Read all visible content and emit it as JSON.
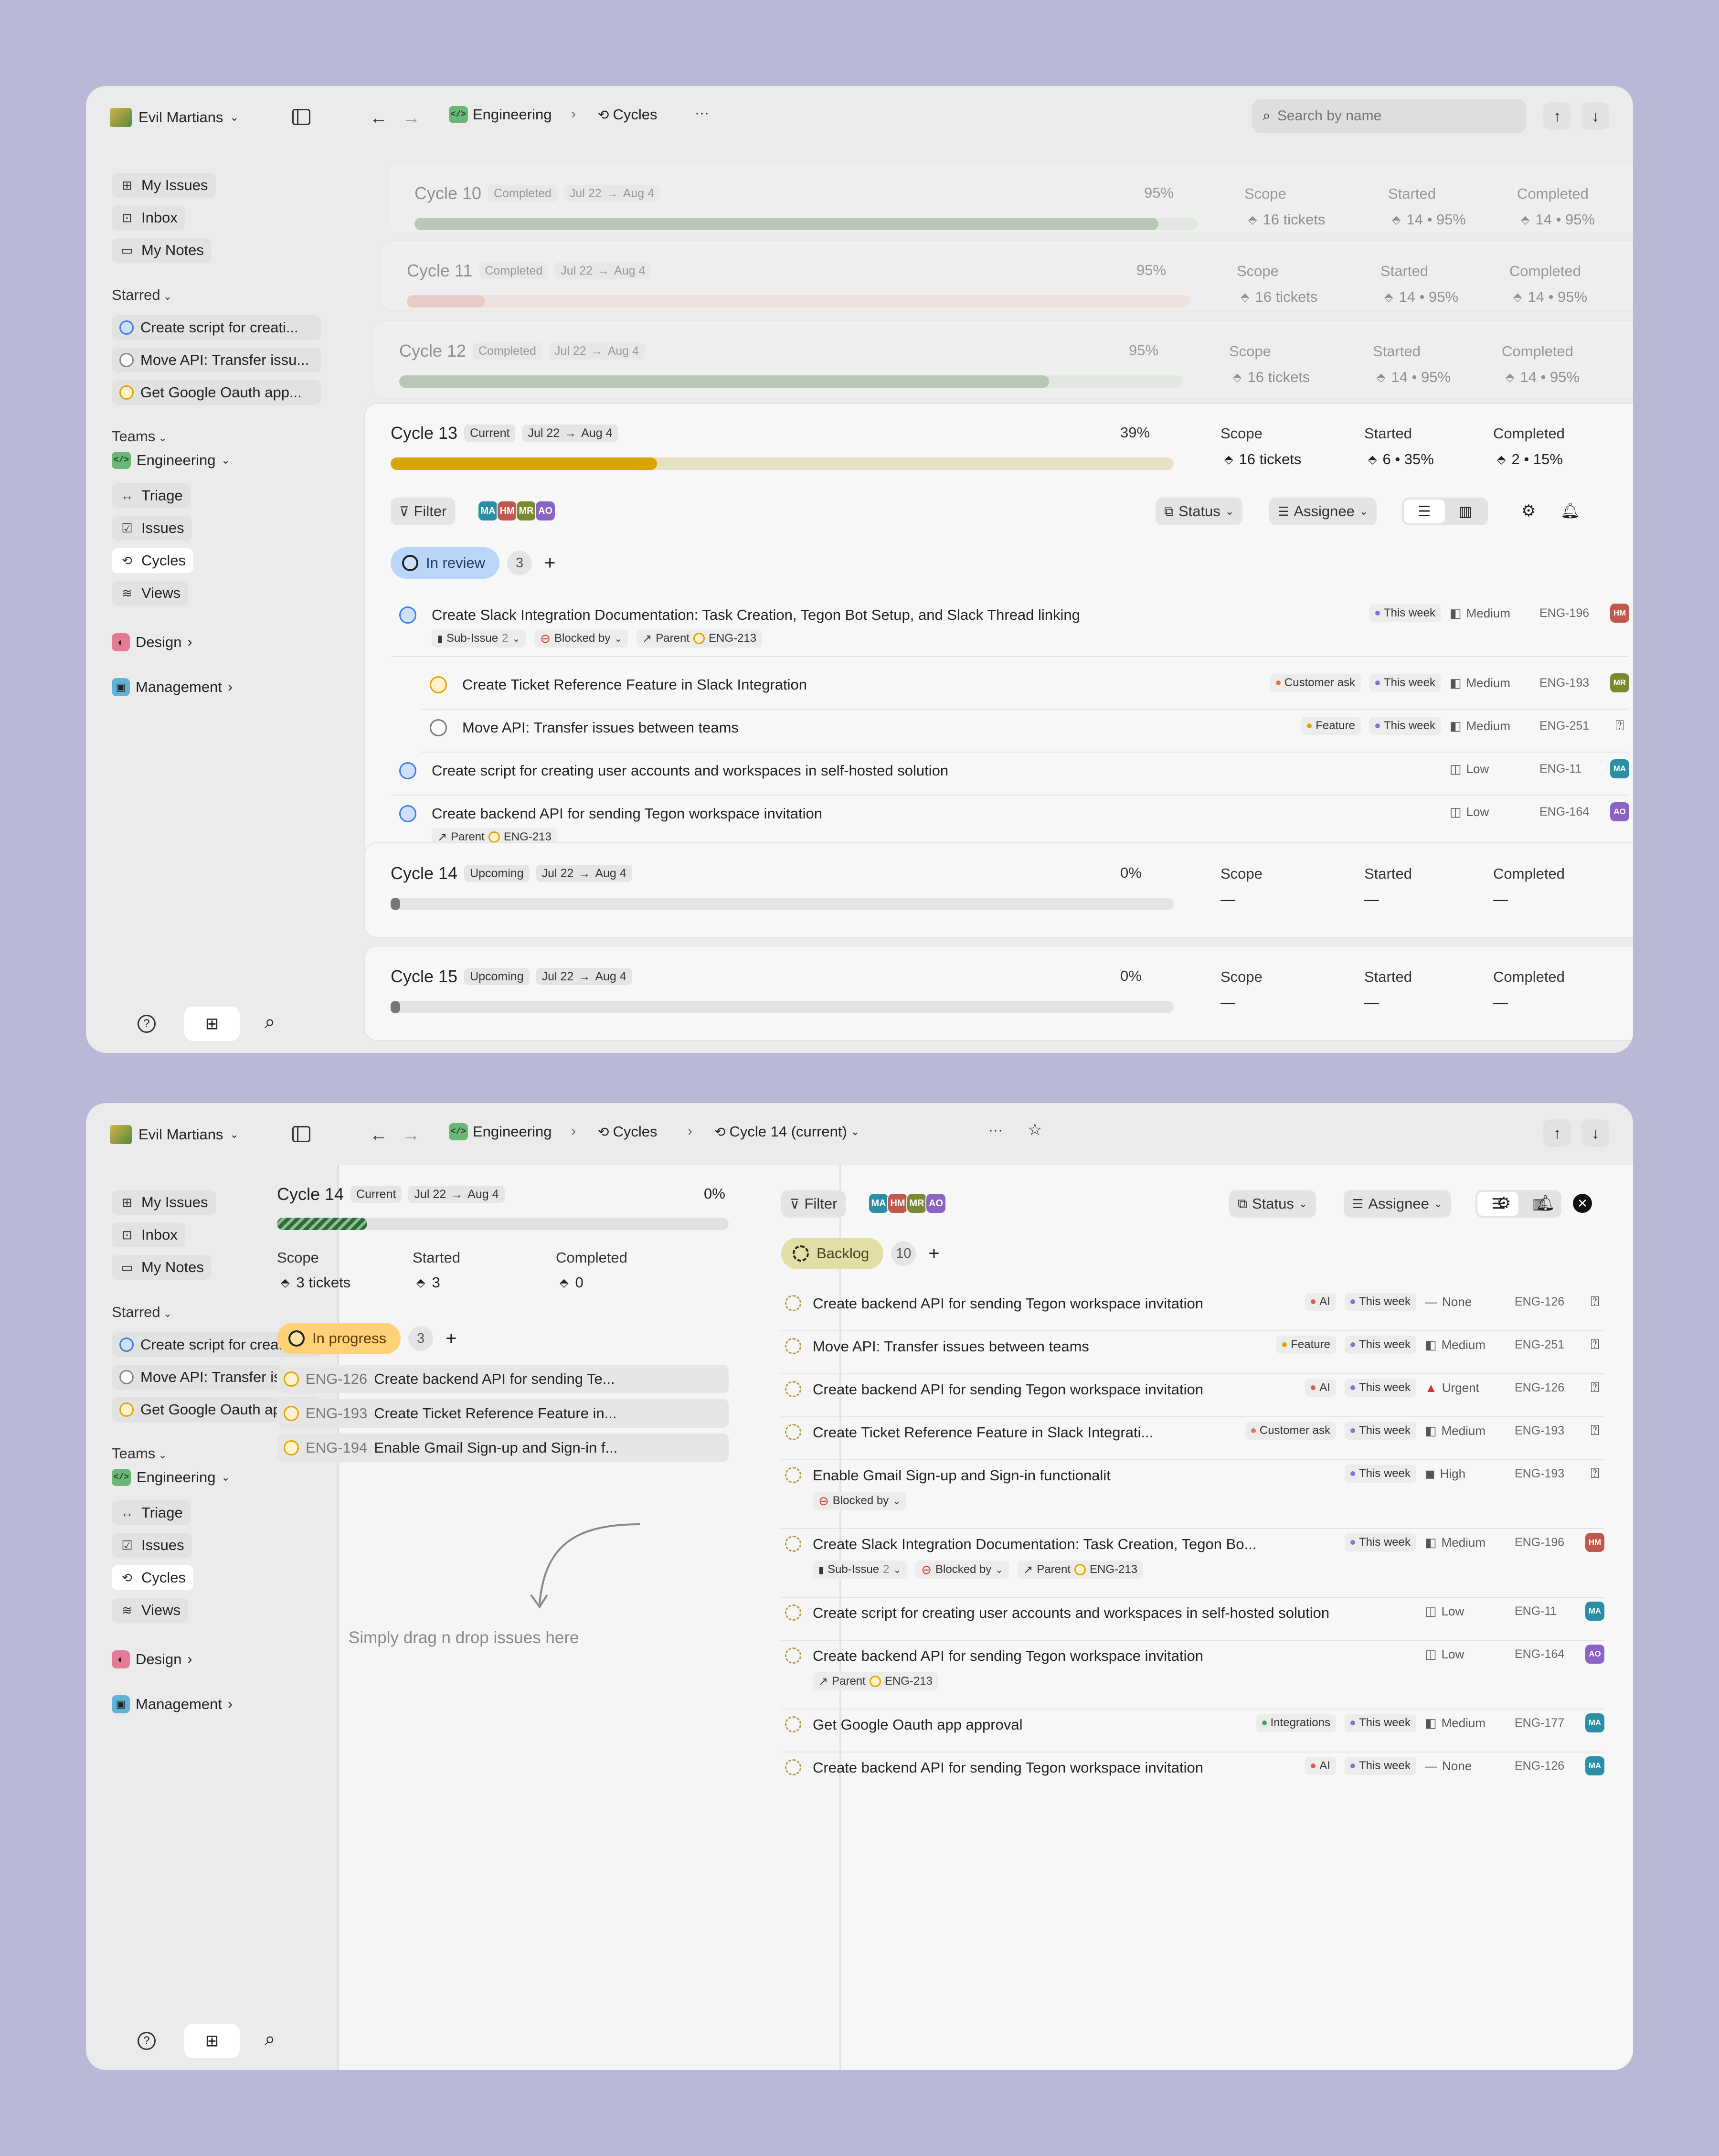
{
  "colors": {
    "background": "#b9b8d6",
    "window": "#ebebeb",
    "engineering": "#6cb777",
    "completed_bar": "#7d9f78",
    "current_bar": "#d9a400",
    "in_review": "#b9d6f8",
    "in_progress": "#ffd27a",
    "backlog": "#e1dfa6"
  },
  "sidebar": {
    "workspace": "Evil Martians",
    "items": [
      {
        "label": "My Issues",
        "icon": "grid-icon"
      },
      {
        "label": "Inbox",
        "icon": "inbox-icon"
      },
      {
        "label": "My Notes",
        "icon": "note-icon"
      }
    ],
    "starred_label": "Starred",
    "starred": [
      "Create script for creati...",
      "Move API: Transfer issu...",
      "Get Google Oauth app..."
    ],
    "teams_label": "Teams",
    "engineering": "Engineering",
    "team_items": [
      {
        "label": "Triage",
        "icon": "triage-icon"
      },
      {
        "label": "Issues",
        "icon": "check-icon"
      },
      {
        "label": "Cycles",
        "icon": "cycle-icon"
      },
      {
        "label": "Views",
        "icon": "layers-icon"
      }
    ],
    "design": "Design",
    "management": "Management"
  },
  "topbar1": {
    "crumb1": "Engineering",
    "crumb2": "Cycles",
    "more": "···",
    "search_placeholder": "Search by name"
  },
  "topbar2": {
    "crumb1": "Engineering",
    "crumb2": "Cycles",
    "crumb3": "Cycle 14 (current)",
    "more": "···"
  },
  "stats_labels": {
    "scope": "Scope",
    "started": "Started",
    "completed": "Completed"
  },
  "cycles": [
    {
      "name": "Cycle 10",
      "status": "Completed",
      "from": "Jul 22",
      "to": "Aug 4",
      "pct": "95%",
      "progress": 0.95,
      "scope": "16 tickets",
      "started": "14 • 95%",
      "completed": "14 • 95%"
    },
    {
      "name": "Cycle 11",
      "status": "Completed",
      "from": "Jul 22",
      "to": "Aug 4",
      "pct": "95%",
      "progress": 0.1,
      "scope": "16 tickets",
      "started": "14 • 95%",
      "completed": "14 • 95%"
    },
    {
      "name": "Cycle 12",
      "status": "Completed",
      "from": "Jul 22",
      "to": "Aug 4",
      "pct": "95%",
      "progress": 0.83,
      "scope": "16 tickets",
      "started": "14 • 95%",
      "completed": "14 • 95%"
    },
    {
      "name": "Cycle 13",
      "status": "Current",
      "from": "Jul 22",
      "to": "Aug 4",
      "pct": "39%",
      "progress": 0.34,
      "scope": "16 tickets",
      "started": "6 • 35%",
      "completed": "2 • 15%"
    },
    {
      "name": "Cycle 14",
      "status": "Upcoming",
      "from": "Jul 22",
      "to": "Aug 4",
      "pct": "0%",
      "progress": 0,
      "scope": "—",
      "started": "—",
      "completed": "—"
    },
    {
      "name": "Cycle 15",
      "status": "Upcoming",
      "from": "Jul 22",
      "to": "Aug 4",
      "pct": "0%",
      "progress": 0,
      "scope": "—",
      "started": "—",
      "completed": "—"
    }
  ],
  "toolbar": {
    "filter": "Filter",
    "status": "Status",
    "assignee": "Assignee",
    "avatars": [
      {
        "i": "MA",
        "c": "#2a8fa5"
      },
      {
        "i": "HM",
        "c": "#c0584d"
      },
      {
        "i": "MR",
        "c": "#7a8a2e"
      },
      {
        "i": "AO",
        "c": "#8a63c4"
      }
    ]
  },
  "review_group": {
    "label": "In review",
    "count": "3",
    "add": "+"
  },
  "issues13": [
    {
      "title": "Create Slack Integration Documentation: Task Creation, Tegon Bot Setup, and Slack Thread linking",
      "tags": [
        {
          "t": "This week",
          "c": "#8b6fd6"
        }
      ],
      "priority": "Medium",
      "id": "ENG-196",
      "av": "HM",
      "avc": "#c0584d",
      "sub": "Sub-Issue",
      "subn": "2",
      "blocked": "Blocked by",
      "parent": "Parent",
      "parentid": "ENG-213"
    },
    {
      "title": "Create Ticket Reference Feature in Slack Integration",
      "tags": [
        {
          "t": "Customer ask",
          "c": "#e07a3a"
        },
        {
          "t": "This week",
          "c": "#8b6fd6"
        }
      ],
      "priority": "Medium",
      "id": "ENG-193",
      "av": "MR",
      "avc": "#7a8a2e"
    },
    {
      "title": "Move API: Transfer issues between teams",
      "tags": [
        {
          "t": "Feature",
          "c": "#d9a400"
        },
        {
          "t": "This week",
          "c": "#8b6fd6"
        }
      ],
      "priority": "Medium",
      "id": "ENG-251"
    },
    {
      "title": "Create script for creating user accounts and workspaces in self-hosted solution",
      "priority": "Low",
      "id": "ENG-11",
      "av": "MA",
      "avc": "#2a8fa5"
    },
    {
      "title": "Create backend API for sending Tegon workspace invitation",
      "priority": "Low",
      "id": "ENG-164",
      "av": "AO",
      "avc": "#8a63c4",
      "parent": "Parent",
      "parentid": "ENG-213"
    }
  ],
  "cycle14": {
    "name": "Cycle 14",
    "status": "Current",
    "from": "Jul 22",
    "to": "Aug 4",
    "pct": "0%",
    "progress": 0.2,
    "scope": "3 tickets",
    "started": "3",
    "completed": "0"
  },
  "progress_group": {
    "label": "In progress",
    "count": "3",
    "add": "+"
  },
  "progress_items": [
    {
      "id": "ENG-126",
      "title": "Create backend API for sending Te..."
    },
    {
      "id": "ENG-193",
      "title": "Create Ticket Reference Feature in..."
    },
    {
      "id": "ENG-194",
      "title": "Enable Gmail Sign-up and Sign-in f..."
    }
  ],
  "drop_hint": "Simply drag n drop issues here",
  "backlog_group": {
    "label": "Backlog",
    "count": "10",
    "add": "+"
  },
  "backlog": [
    {
      "title": "Create backend API for sending Tegon workspace invitation",
      "tags": [
        {
          "t": "AI",
          "c": "#e05a4a"
        },
        {
          "t": "This week",
          "c": "#8b6fd6"
        }
      ],
      "priority": "None",
      "id": "ENG-126"
    },
    {
      "title": "Move API: Transfer issues between teams",
      "tags": [
        {
          "t": "Feature",
          "c": "#d9a400"
        },
        {
          "t": "This week",
          "c": "#8b6fd6"
        }
      ],
      "priority": "Medium",
      "id": "ENG-251"
    },
    {
      "title": "Create backend API for sending Tegon workspace invitation",
      "tags": [
        {
          "t": "AI",
          "c": "#e05a4a"
        },
        {
          "t": "This week",
          "c": "#8b6fd6"
        }
      ],
      "priority": "Urgent",
      "id": "ENG-126"
    },
    {
      "title": "Create Ticket Reference Feature in Slack Integrati...",
      "tags": [
        {
          "t": "Customer ask",
          "c": "#e07a3a"
        },
        {
          "t": "This week",
          "c": "#8b6fd6"
        }
      ],
      "priority": "Medium",
      "id": "ENG-193"
    },
    {
      "title": "Enable Gmail Sign-up and Sign-in functionalit",
      "tags": [
        {
          "t": "This week",
          "c": "#8b6fd6"
        }
      ],
      "priority": "High",
      "id": "ENG-193",
      "blocked": "Blocked by"
    },
    {
      "title": "Create Slack Integration Documentation: Task Creation, Tegon Bo...",
      "tags": [
        {
          "t": "This week",
          "c": "#8b6fd6"
        }
      ],
      "priority": "Medium",
      "id": "ENG-196",
      "av": "HM",
      "avc": "#c0584d",
      "sub": "Sub-Issue",
      "subn": "2",
      "blocked": "Blocked by",
      "parent": "Parent",
      "parentid": "ENG-213"
    },
    {
      "title": "Create script for creating user accounts and workspaces in self-hosted solution",
      "priority": "Low",
      "id": "ENG-11",
      "av": "MA",
      "avc": "#2a8fa5"
    },
    {
      "title": "Create backend API for sending Tegon workspace invitation",
      "priority": "Low",
      "id": "ENG-164",
      "av": "AO",
      "avc": "#8a63c4",
      "parent": "Parent",
      "parentid": "ENG-213"
    },
    {
      "title": "Get Google Oauth app approval",
      "tags": [
        {
          "t": "Integrations",
          "c": "#3aaa5a"
        },
        {
          "t": "This week",
          "c": "#8b6fd6"
        }
      ],
      "priority": "Medium",
      "id": "ENG-177",
      "av": "MA",
      "avc": "#2a8fa5"
    },
    {
      "title": "Create backend API for sending Tegon workspace invitation",
      "tags": [
        {
          "t": "AI",
          "c": "#e05a4a"
        },
        {
          "t": "This week",
          "c": "#8b6fd6"
        }
      ],
      "priority": "None",
      "id": "ENG-126",
      "av": "MA",
      "avc": "#2a8fa5"
    }
  ]
}
